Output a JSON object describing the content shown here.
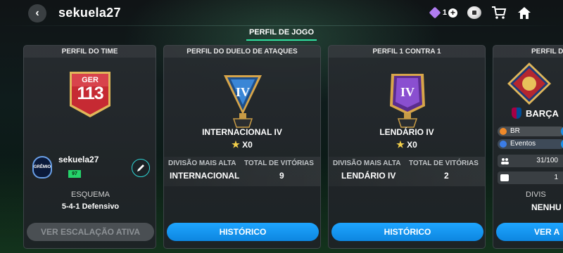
{
  "header": {
    "back_glyph": "‹",
    "title": "sekuela27",
    "currency_value": "1",
    "icons": [
      "tag-icon",
      "plus-icon",
      "ball-icon",
      "cart-icon",
      "home-icon"
    ]
  },
  "tabs": [
    {
      "label": "PERFIL DE JOGO",
      "active": true
    }
  ],
  "cards": {
    "time": {
      "header": "PERFIL DO TIME",
      "rating_label": "GER",
      "rating_value": "113",
      "username": "sekuela27",
      "club_crest_text": "GRÊMIO",
      "level": "97",
      "scheme_label": "ESQUEMA",
      "scheme_value": "5-4-1 Defensivo",
      "button_label": "VER ESCALAÇÃO ATIVA"
    },
    "duel": {
      "header": "PERFIL DO DUELO DE ATAQUES",
      "trophy_numeral": "IV",
      "division_name": "INTERNACIONAL IV",
      "stars": "X0",
      "stat_label_1": "DIVISÃO MAIS ALTA",
      "stat_value_1": "INTERNACIONAL",
      "stat_label_2": "TOTAL DE VITÓRIAS",
      "stat_value_2": "9",
      "button_label": "HISTÓRICO"
    },
    "one_vs_one": {
      "header": "PERFIL 1 CONTRA 1",
      "trophy_numeral": "IV",
      "division_name": "LENDÁRIO IV",
      "stars": "X0",
      "stat_label_1": "DIVISÃO MAIS ALTA",
      "stat_value_1": "LENDÁRIO IV",
      "stat_label_2": "TOTAL DE VITÓRIAS",
      "stat_value_2": "2",
      "button_label": "HISTÓRICO"
    },
    "clube": {
      "header": "PERFIL D",
      "club_name": "BARÇA",
      "region_pill": "BR",
      "events_pill": "Eventos",
      "members": "31/100",
      "count_2": "1",
      "division_label": "DIVIS",
      "division_value": "NENHU",
      "button_label": "VER A"
    }
  },
  "colors": {
    "accent_green": "#2fe0a0",
    "button_blue": "#1ea5ff",
    "badge_red": "#c62a33",
    "gold": "#e0b75a",
    "level_green": "#25d36a"
  }
}
